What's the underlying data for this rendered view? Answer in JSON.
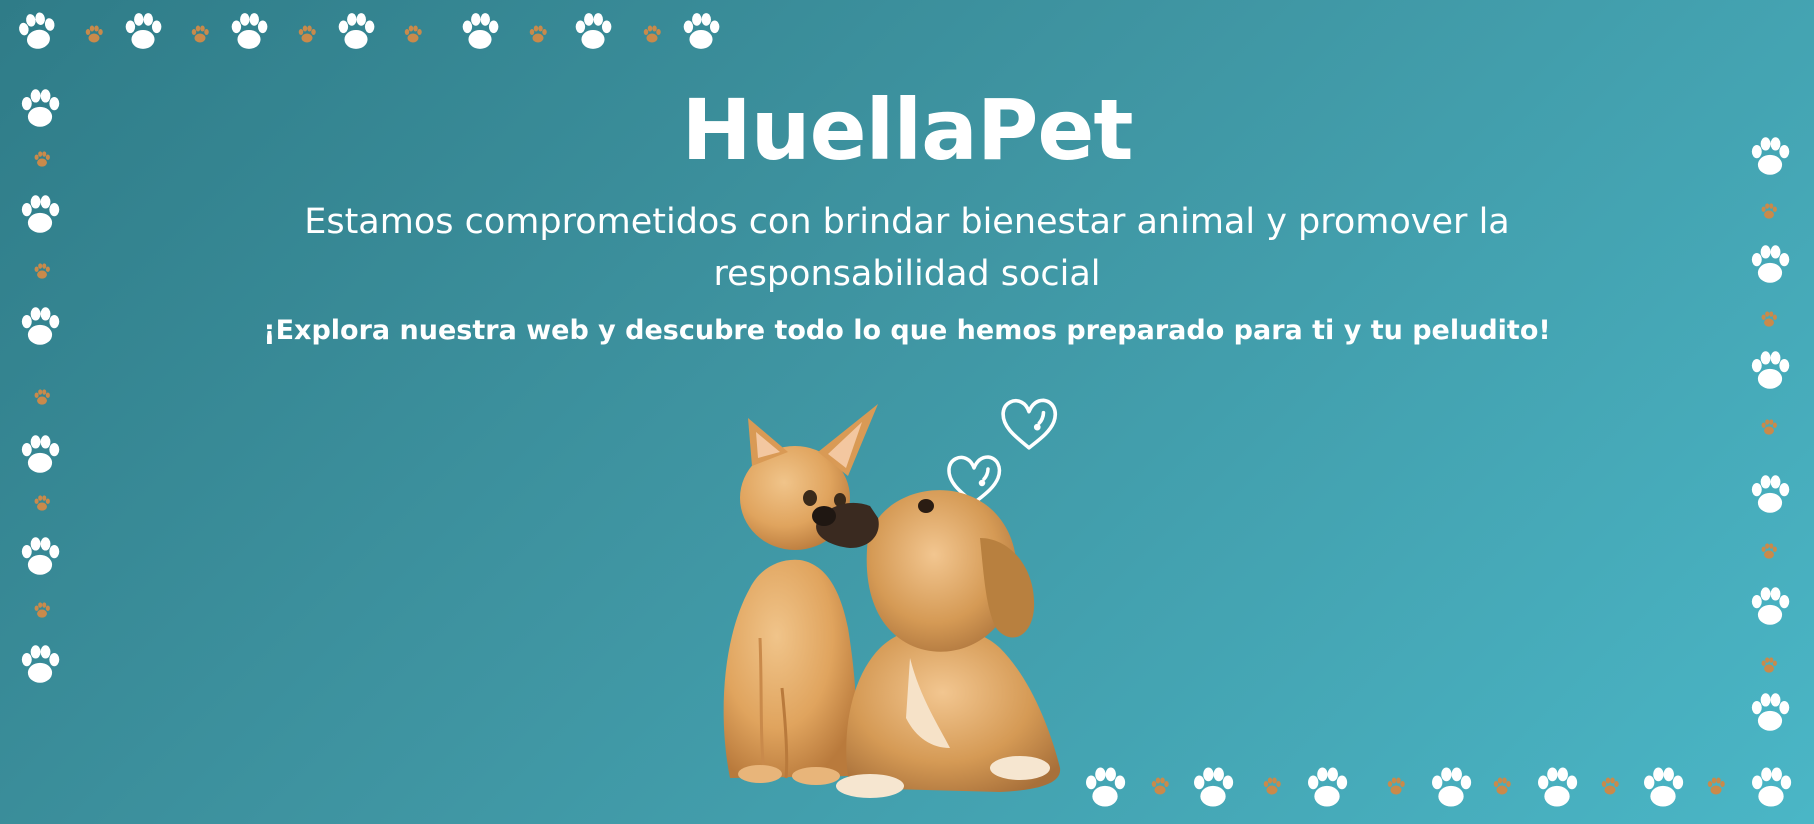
{
  "banner": {
    "title": "HuellaPet",
    "tagline": "Estamos comprometidos con brindar bienestar animal y promover la responsabilidad social",
    "cta": "¡Explora nuestra web y descubre todo lo que hemos preparado para ti y tu peludito!"
  },
  "colors": {
    "background_start": "#2f7c88",
    "background_end": "#4ab6c6",
    "text": "#ffffff",
    "paw_large": "#ffffff",
    "paw_small": "#c98a4b",
    "cat_fur": "#e0a45e",
    "dog_fur": "#d59a55"
  },
  "icons": {
    "paw": "paw-print-icon",
    "heart": "heart-icon"
  }
}
